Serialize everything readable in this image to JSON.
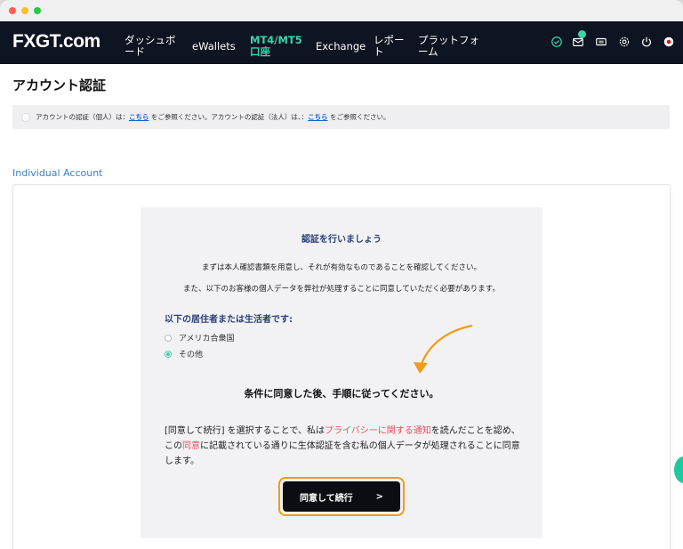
{
  "nav": {
    "logo_fx": "FX",
    "logo_gt": "GT",
    "logo_com": ".com",
    "items": [
      {
        "line1": "ダッシュボ",
        "line2": "ード"
      },
      {
        "line1": "eWallets",
        "line2": ""
      },
      {
        "line1": "MT4/MT5",
        "line2": "口座"
      },
      {
        "line1": "Exchange",
        "line2": ""
      },
      {
        "line1": "レポー",
        "line2": "ト"
      },
      {
        "line1": "プラットフォ",
        "line2": "ーム"
      }
    ],
    "icons": [
      "verified-check-icon",
      "mail-icon",
      "ticket-icon",
      "gear-icon",
      "power-icon",
      "language-flag-icon"
    ]
  },
  "page": {
    "title": "アカウント認証",
    "notice": {
      "part1": "アカウントの認証（個人）は：",
      "link1": "こちら",
      "part2": " をご参照ください。アカウントの認証（法人）は、：",
      "link2": "こちら",
      "part3": " をご参照ください。"
    },
    "section_link": "Individual Account",
    "verification": {
      "heading": "認証を行いましょう",
      "line1": "まずは本人確認書類を用意し、それが有効なものであることを確認してください。",
      "line2": "また、以下のお客様の個人データを弊社が処理することに同意していただく必要があります。",
      "residence_title": "以下の居住者または生活者です:",
      "options": [
        {
          "label": "アメリカ合衆国",
          "selected": false
        },
        {
          "label": "その他",
          "selected": true
        }
      ],
      "conditions": "条件に同意した後、手順に従ってください。",
      "para": {
        "p1": "[同意して続行] を選択することで、私は",
        "link1": "プライバシーに関する通知",
        "p2": "を読んだことを認め、この",
        "link2": "同意",
        "p3": "に記載されている通りに生体認証を含む私の個人データが処理されることに同意します。"
      },
      "cta_label": "同意して続行",
      "cta_chevron": ">"
    }
  },
  "colors": {
    "nav_bg": "#0f1422",
    "accent_teal": "#3bd3ab",
    "highlight_orange": "#f29b1a",
    "link_red": "#e8505b"
  }
}
